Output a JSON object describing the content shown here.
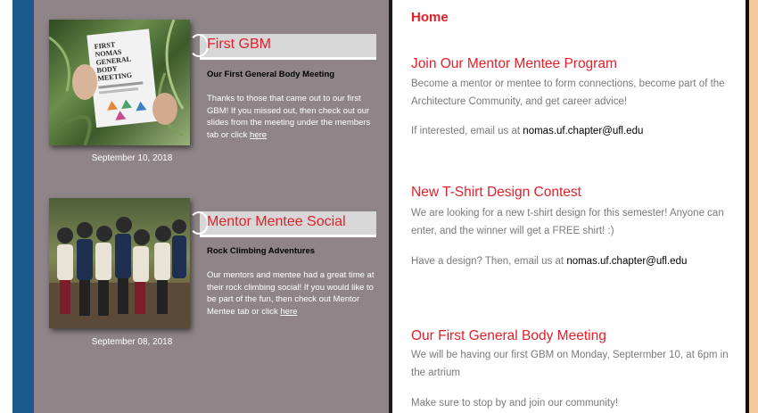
{
  "events": [
    {
      "title": "First GBM",
      "subtitle": "Our First General Body Meeting",
      "description": "Thanks to those that came out to our first GBM! If you missed out, then check out our slides from the meeting under the members tab or click ",
      "link_text": "here",
      "date": "September 10, 2018",
      "flyer_lines": [
        "FIRST",
        "NOMAS",
        "GENERAL",
        "BODY",
        "MEETING"
      ]
    },
    {
      "title": "Mentor Mentee Social",
      "subtitle": "Rock Climbing Adventures",
      "description": "Our mentors and mentee had a great time at their rock climbing social! If you would like to be part of the fun, then check out Mentor Mentee tab or click ",
      "link_text": "here",
      "date": "September 08, 2018"
    }
  ],
  "home": {
    "title": "Home",
    "posts": [
      {
        "title": "Join Our Mentor Mentee Program",
        "body": "Become a mentor or mentee to form connections, become part of the Architecture Community, and get career advice!",
        "contact_prefix": "If interested, email us at ",
        "email": "nomas.uf.chapter@ufl.edu"
      },
      {
        "title": "New T-Shirt Design Contest",
        "body": "We are looking for a new t-shirt design for this semester! Anyone can enter, and the winner will get a FREE shirt! :)",
        "contact_prefix": "Have a design? Then, email us at ",
        "email": "nomas.uf.chapter@ufl.edu"
      },
      {
        "title": "Our First General Body Meeting",
        "body": "We will be having our first GBM on Monday, Septermber 10, at 6pm in the artrium",
        "footer": "Make sure to stop by and join our community!"
      }
    ]
  },
  "colors": {
    "accent_red": "#e2202a",
    "sidebar_blue": "#1c5a8e",
    "panel_gray": "#8f8588"
  }
}
